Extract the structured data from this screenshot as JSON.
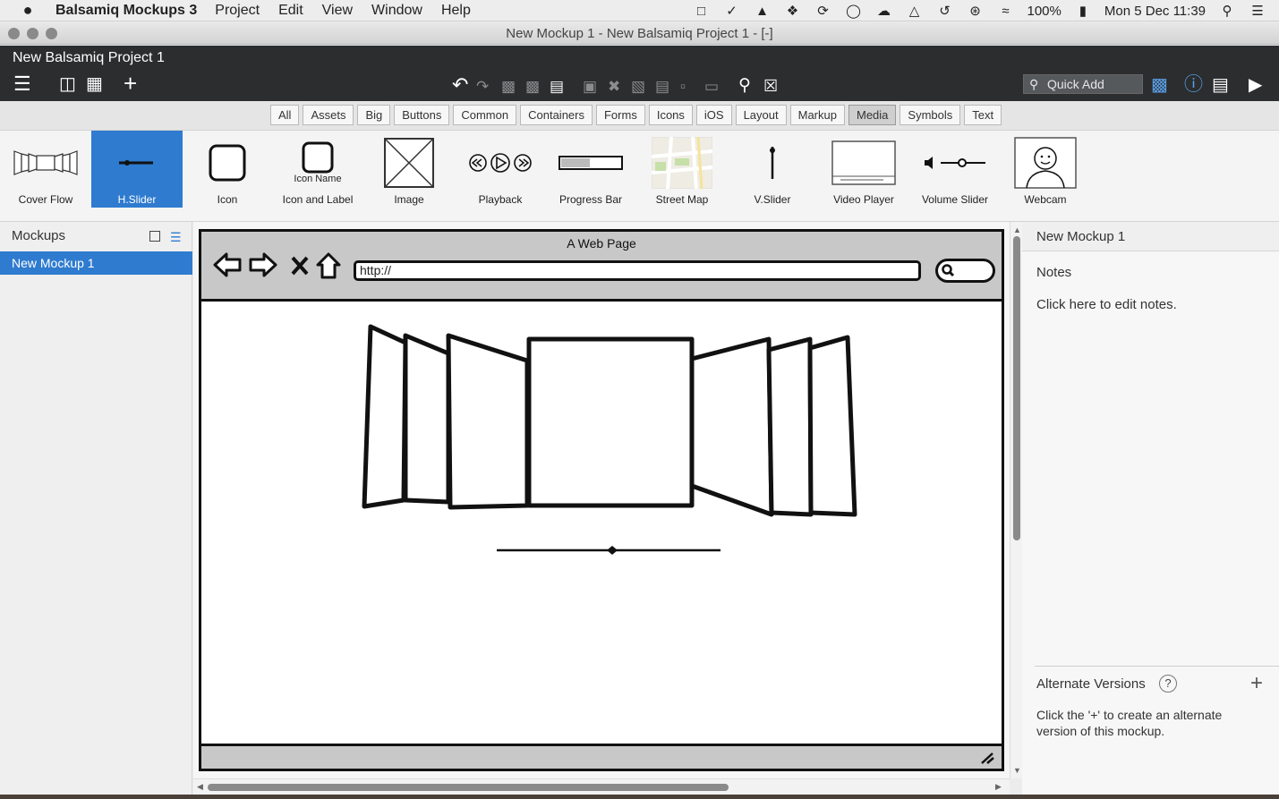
{
  "menubar": {
    "apple": "",
    "app_name": "Balsamiq Mockups 3",
    "items": [
      "Project",
      "Edit",
      "View",
      "Window",
      "Help"
    ],
    "battery": "100%",
    "clock": "Mon 5 Dec  11:39"
  },
  "window": {
    "title": "New Mockup 1 - New Balsamiq Project 1 - [-]"
  },
  "app": {
    "project_name": "New Balsamiq Project 1",
    "quick_add_placeholder": "Quick Add"
  },
  "library": {
    "filters": [
      "All",
      "Assets",
      "Big",
      "Buttons",
      "Common",
      "Containers",
      "Forms",
      "Icons",
      "iOS",
      "Layout",
      "Markup",
      "Media",
      "Symbols",
      "Text"
    ],
    "active_filter": "Media",
    "components": [
      {
        "label": "Cover Flow",
        "icon": "cover-flow-icon"
      },
      {
        "label": "H.Slider",
        "icon": "h-slider-icon",
        "selected": true
      },
      {
        "label": "Icon",
        "icon": "icon-icon"
      },
      {
        "label": "Icon and Label",
        "icon": "icon-and-label-icon",
        "sublabel": "Icon Name"
      },
      {
        "label": "Image",
        "icon": "image-icon"
      },
      {
        "label": "Playback",
        "icon": "playback-icon"
      },
      {
        "label": "Progress Bar",
        "icon": "progress-bar-icon"
      },
      {
        "label": "Street Map",
        "icon": "street-map-icon"
      },
      {
        "label": "V.Slider",
        "icon": "v-slider-icon"
      },
      {
        "label": "Video Player",
        "icon": "video-player-icon"
      },
      {
        "label": "Volume Slider",
        "icon": "volume-slider-icon"
      },
      {
        "label": "Webcam",
        "icon": "webcam-icon"
      }
    ]
  },
  "mockups_panel": {
    "title": "Mockups",
    "items": [
      "New Mockup 1"
    ]
  },
  "canvas": {
    "browser_title": "A Web Page",
    "url": "http://"
  },
  "properties": {
    "title": "New Mockup 1",
    "notes_label": "Notes",
    "notes_hint": "Click here to edit notes.",
    "alt_versions_label": "Alternate Versions",
    "alt_help": "?",
    "alt_hint": "Click the '+' to create an alternate version of this mockup."
  },
  "colors": {
    "accent": "#2e7bcf",
    "header": "#2b2d2f"
  }
}
